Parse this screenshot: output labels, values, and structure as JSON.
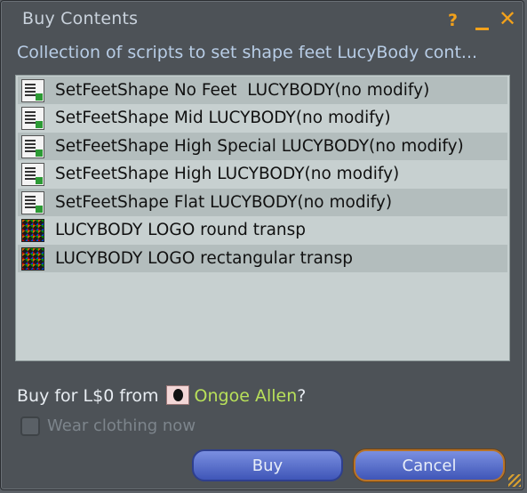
{
  "window": {
    "title": "Buy Contents",
    "help_icon": "?",
    "close_icon": "✕"
  },
  "description": "Collection of scripts to set shape feet LucyBody cont...",
  "items": [
    {
      "label": "SetFeetShape No Feet  LUCYBODY(no modify)",
      "icon": "script-icon"
    },
    {
      "label": "SetFeetShape Mid LUCYBODY(no modify)",
      "icon": "script-icon"
    },
    {
      "label": "SetFeetShape High Special LUCYBODY(no modify)",
      "icon": "script-icon"
    },
    {
      "label": "SetFeetShape High LUCYBODY(no modify)",
      "icon": "script-icon"
    },
    {
      "label": "SetFeetShape Flat LUCYBODY(no modify)",
      "icon": "script-icon"
    },
    {
      "label": "LUCYBODY LOGO round transp",
      "icon": "texture-icon"
    },
    {
      "label": "LUCYBODY LOGO rectangular transp",
      "icon": "texture-icon"
    }
  ],
  "purchase": {
    "prefix": "Buy for L$0 from",
    "seller": "Ongoe Allen",
    "suffix": "?"
  },
  "wear_clothing": {
    "label": "Wear clothing now",
    "checked": false,
    "enabled": false
  },
  "buttons": {
    "buy": "Buy",
    "cancel": "Cancel"
  },
  "colors": {
    "accent": "#f2a11b",
    "seller_link": "#b8e05a",
    "button": "#4f66c8"
  }
}
